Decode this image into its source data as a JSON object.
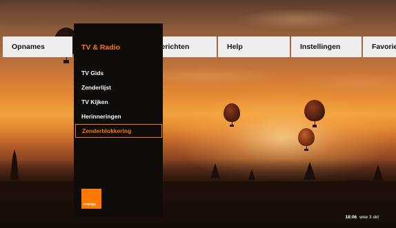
{
  "top_menu": {
    "items": [
      {
        "label": "Opnames"
      },
      {
        "label": "TV & Radio"
      },
      {
        "label": "Berichten"
      },
      {
        "label": "Help"
      },
      {
        "label": "Instellingen"
      },
      {
        "label": "Favorieten"
      }
    ],
    "active_index": 1
  },
  "submenu": {
    "items": [
      {
        "label": "TV Gids"
      },
      {
        "label": "Zenderlijst"
      },
      {
        "label": "TV Kijken"
      },
      {
        "label": "Herinneringen"
      },
      {
        "label": "Zenderblokkering"
      }
    ],
    "selected_index": 4
  },
  "brand": {
    "logo_text": "orange",
    "accent_color": "#ff7900"
  },
  "status": {
    "time": "18:06",
    "date": "woe 3 okt"
  }
}
